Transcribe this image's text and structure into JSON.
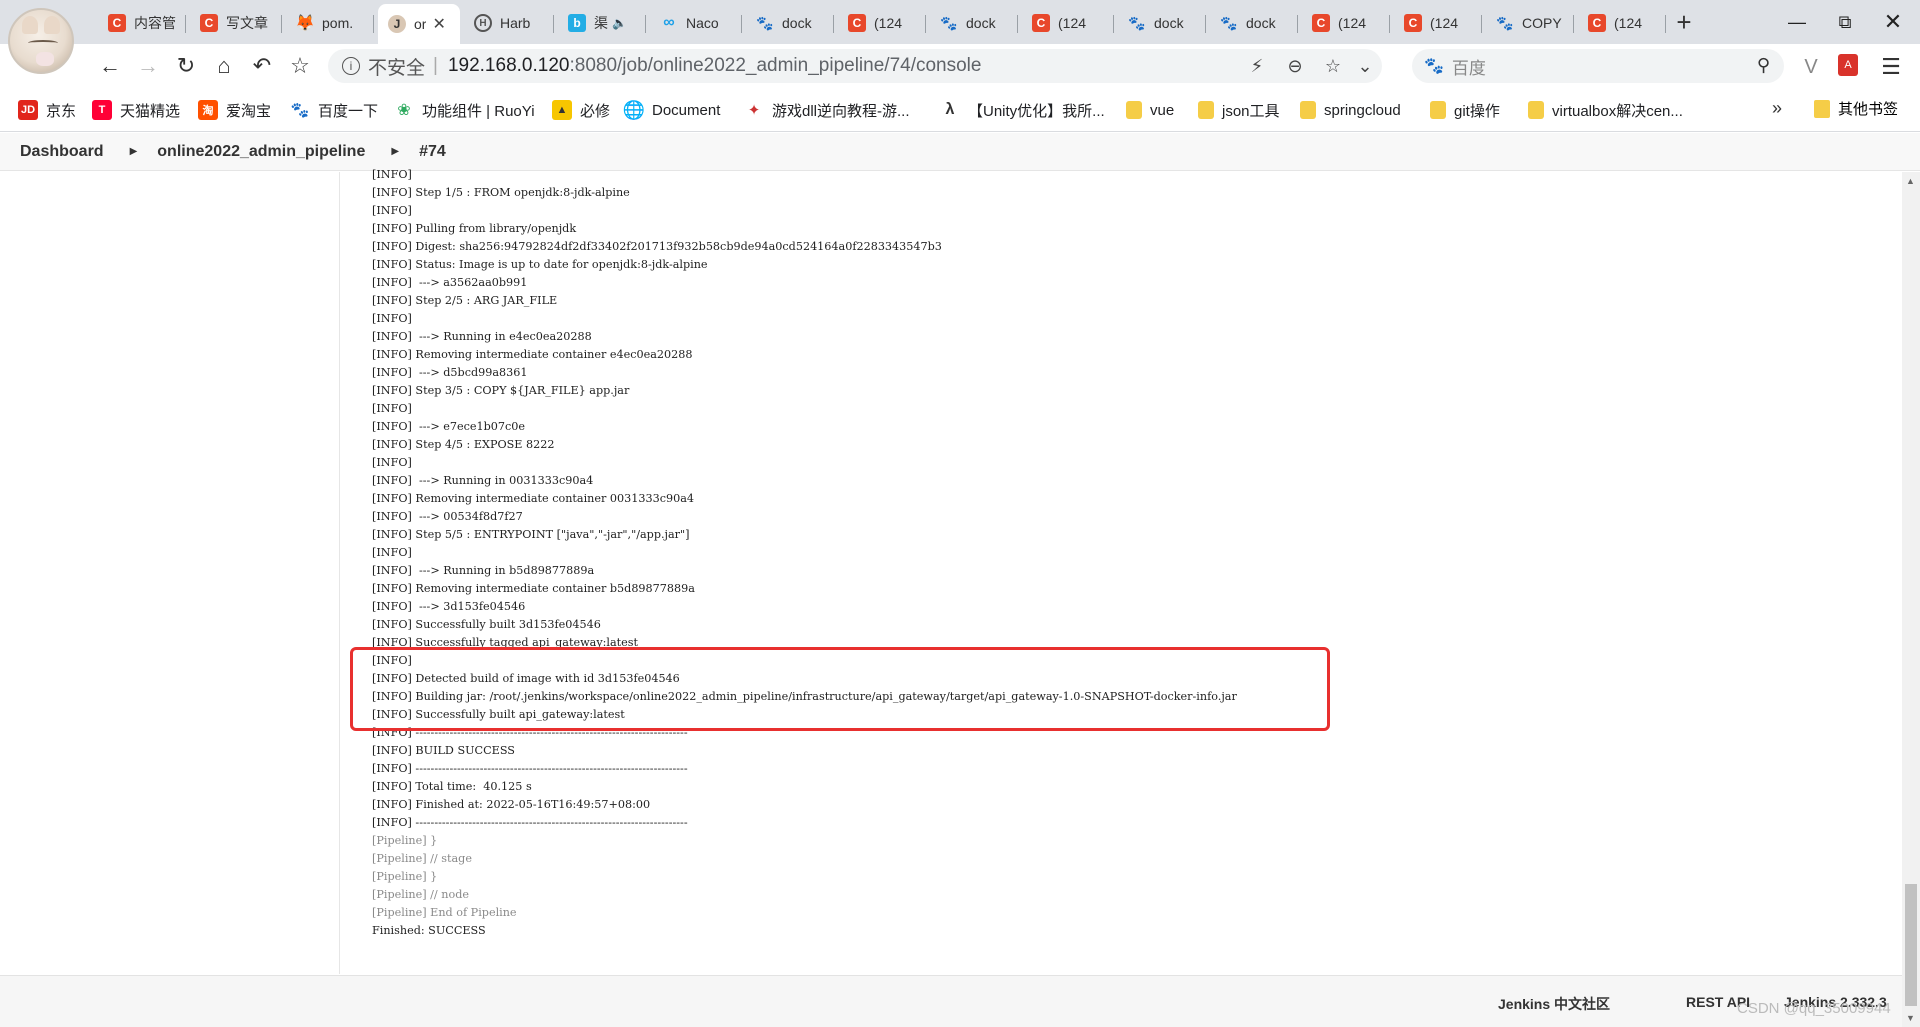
{
  "browser": {
    "tabs": [
      {
        "label": "内容管",
        "icon": "csdn-icon"
      },
      {
        "label": "写文章",
        "icon": "csdn-icon"
      },
      {
        "label": "pom.",
        "icon": "gitlab-icon"
      },
      {
        "label": "or",
        "icon": "jenkins-icon",
        "active": true
      },
      {
        "label": "Harb",
        "icon": "harbor-icon"
      },
      {
        "label": "渠",
        "icon": "bilibili-icon"
      },
      {
        "label": "Naco",
        "icon": "nacos-icon"
      },
      {
        "label": "dock",
        "icon": "baidu-icon"
      },
      {
        "label": "(124",
        "icon": "csdn-icon"
      },
      {
        "label": "dock",
        "icon": "baidu-icon"
      },
      {
        "label": "(124",
        "icon": "csdn-icon"
      },
      {
        "label": "dock",
        "icon": "baidu-icon"
      },
      {
        "label": "dock",
        "icon": "baidu-icon"
      },
      {
        "label": "(124",
        "icon": "csdn-icon"
      },
      {
        "label": "(124",
        "icon": "csdn-icon"
      },
      {
        "label": "COPY",
        "icon": "baidu-icon"
      },
      {
        "label": "(124",
        "icon": "csdn-icon"
      }
    ],
    "url": {
      "insecure_label": "不安全",
      "host": "192.168.0.120",
      "path": ":8080/job/online2022_admin_pipeline/74/console"
    },
    "search": {
      "placeholder": "百度"
    },
    "bookmarks": [
      {
        "label": "京东",
        "icon": "jd-icon"
      },
      {
        "label": "天猫精选",
        "icon": "tmall-icon"
      },
      {
        "label": "爱淘宝",
        "icon": "taobao-icon"
      },
      {
        "label": "百度一下",
        "icon": "baidu-icon"
      },
      {
        "label": "功能组件 | RuoYi",
        "icon": "ruoyi-icon"
      },
      {
        "label": "必修",
        "icon": "bixiu-icon"
      },
      {
        "label": "Document",
        "icon": "globe-icon"
      },
      {
        "label": "游戏dll逆向教程-游...",
        "icon": "game-icon"
      },
      {
        "label": "【Unity优化】我所...",
        "icon": "unity-icon"
      },
      {
        "label": "vue",
        "icon": "folder-icon"
      },
      {
        "label": "json工具",
        "icon": "folder-icon"
      },
      {
        "label": "springcloud",
        "icon": "folder-icon"
      },
      {
        "label": "git操作",
        "icon": "folder-icon"
      },
      {
        "label": "virtualbox解决cen...",
        "icon": "folder-icon"
      }
    ],
    "bookmarks_more": "»",
    "other_bookmarks": "其他书签"
  },
  "jenkins": {
    "breadcrumb": [
      "Dashboard",
      "online2022_admin_pipeline",
      "#74"
    ],
    "console_lines": [
      {
        "text": "[INFO]",
        "type": "info"
      },
      {
        "text": "[INFO] Step 1/5 : FROM openjdk:8-jdk-alpine",
        "type": "info"
      },
      {
        "text": "[INFO]",
        "type": "info"
      },
      {
        "text": "[INFO] Pulling from library/openjdk",
        "type": "info"
      },
      {
        "text": "[INFO] Digest: sha256:94792824df2df33402f201713f932b58cb9de94a0cd524164a0f2283343547b3",
        "type": "info"
      },
      {
        "text": "[INFO] Status: Image is up to date for openjdk:8-jdk-alpine",
        "type": "info"
      },
      {
        "text": "[INFO]  ---> a3562aa0b991",
        "type": "info"
      },
      {
        "text": "[INFO] Step 2/5 : ARG JAR_FILE",
        "type": "info"
      },
      {
        "text": "[INFO]",
        "type": "info"
      },
      {
        "text": "[INFO]  ---> Running in e4ec0ea20288",
        "type": "info"
      },
      {
        "text": "[INFO] Removing intermediate container e4ec0ea20288",
        "type": "info"
      },
      {
        "text": "[INFO]  ---> d5bcd99a8361",
        "type": "info"
      },
      {
        "text": "[INFO] Step 3/5 : COPY ${JAR_FILE} app.jar",
        "type": "info"
      },
      {
        "text": "[INFO]",
        "type": "info"
      },
      {
        "text": "[INFO]  ---> e7ece1b07c0e",
        "type": "info"
      },
      {
        "text": "[INFO] Step 4/5 : EXPOSE 8222",
        "type": "info"
      },
      {
        "text": "[INFO]",
        "type": "info"
      },
      {
        "text": "[INFO]  ---> Running in 0031333c90a4",
        "type": "info"
      },
      {
        "text": "[INFO] Removing intermediate container 0031333c90a4",
        "type": "info"
      },
      {
        "text": "[INFO]  ---> 00534f8d7f27",
        "type": "info"
      },
      {
        "text": "[INFO] Step 5/5 : ENTRYPOINT [\"java\",\"-jar\",\"/app.jar\"]",
        "type": "info"
      },
      {
        "text": "[INFO]",
        "type": "info"
      },
      {
        "text": "[INFO]  ---> Running in b5d89877889a",
        "type": "info"
      },
      {
        "text": "[INFO] Removing intermediate container b5d89877889a",
        "type": "info"
      },
      {
        "text": "[INFO]  ---> 3d153fe04546",
        "type": "info"
      },
      {
        "text": "[INFO] Successfully built 3d153fe04546",
        "type": "info"
      },
      {
        "text": "[INFO] Successfully tagged api_gateway:latest",
        "type": "info"
      },
      {
        "text": "[INFO]",
        "type": "info"
      },
      {
        "text": "[INFO] Detected build of image with id 3d153fe04546",
        "type": "info"
      },
      {
        "text": "[INFO] Building jar: /root/.jenkins/workspace/online2022_admin_pipeline/infrastructure/api_gateway/target/api_gateway-1.0-SNAPSHOT-docker-info.jar",
        "type": "info"
      },
      {
        "text": "[INFO] Successfully built api_gateway:latest",
        "type": "info"
      },
      {
        "text": "[INFO] ------------------------------------------------------------------------",
        "type": "info"
      },
      {
        "text": "[INFO] BUILD SUCCESS",
        "type": "info"
      },
      {
        "text": "[INFO] ------------------------------------------------------------------------",
        "type": "info"
      },
      {
        "text": "[INFO] Total time:  40.125 s",
        "type": "info"
      },
      {
        "text": "[INFO] Finished at: 2022-05-16T16:49:57+08:00",
        "type": "info"
      },
      {
        "text": "[INFO] ------------------------------------------------------------------------",
        "type": "info"
      },
      {
        "text": "[Pipeline] }",
        "type": "pipeline"
      },
      {
        "text": "[Pipeline] // stage",
        "type": "pipeline"
      },
      {
        "text": "[Pipeline] }",
        "type": "pipeline"
      },
      {
        "text": "[Pipeline] // node",
        "type": "pipeline"
      },
      {
        "text": "[Pipeline] End of Pipeline",
        "type": "pipeline"
      },
      {
        "text": "Finished: SUCCESS",
        "type": "info"
      }
    ],
    "footer": {
      "community": "Jenkins 中文社区",
      "rest_api": "REST API",
      "version": "Jenkins 2.332.3"
    },
    "highlight_color": "#e8302f"
  },
  "watermark": "CSDN @qq_35009944"
}
